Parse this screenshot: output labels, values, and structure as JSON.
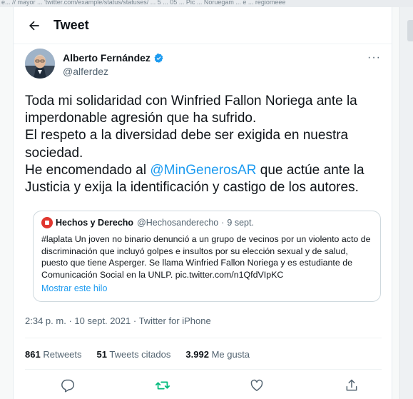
{
  "browser": {
    "url_fragment": "e... // mayor ... 'twitter.com/example/status/statuses/ ... 5 ... 05 ... Pic ... Noruegam ... e ... regiomeee"
  },
  "header": {
    "back_icon": "arrow-left-icon",
    "title": "Tweet"
  },
  "author": {
    "name": "Alberto Fernández",
    "handle": "@alferdez",
    "verified": true
  },
  "tweet": {
    "line1": "Toda mi solidaridad con Winfried Fallon Noriega ante la imperdonable agresión que ha sufrido.",
    "line2": "El respeto a la diversidad debe ser exigida en nuestra sociedad.",
    "line3_before": "He encomendado al ",
    "mention": "@MinGenerosAR",
    "line3_after": " que actúe ante la Justicia y exija la identificación y castigo de los autores."
  },
  "quote": {
    "name": "Hechos y Derecho",
    "handle": "@Hechosanderecho",
    "separator": "·",
    "date": "9 sept.",
    "text": "#laplata Un joven no binario denunció a un grupo de vecinos por un violento acto de discriminación que incluyó golpes e insultos por su elección sexual y de salud, puesto que tiene Asperger. Se llama Winfried Fallon Noriega  y es estudiante de Comunicación Social en la UNLP. pic.twitter.com/n1QfdVIpKC",
    "show_thread": "Mostrar este hilo"
  },
  "meta": {
    "time": "2:34 p. m.",
    "separator": "·",
    "date": "10 sept. 2021",
    "source": "Twitter for iPhone"
  },
  "stats": {
    "retweets_count": "861",
    "retweets_label": "Retweets",
    "quotes_count": "51",
    "quotes_label": "Tweets citados",
    "likes_count": "3.992",
    "likes_label": "Me gusta"
  },
  "actions": {
    "reply_icon": "reply-icon",
    "retweet_icon": "retweet-icon",
    "like_icon": "heart-icon",
    "share_icon": "share-icon"
  },
  "colors": {
    "accent": "#1d9bf0",
    "retweet": "#00ba7c",
    "text": "#0f1419",
    "secondary": "#536471"
  }
}
